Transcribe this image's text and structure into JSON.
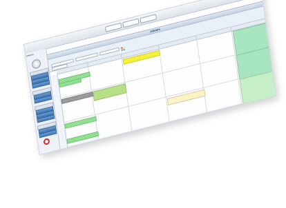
{
  "window": {
    "toolbar_buttons": [
      "",
      "",
      ""
    ],
    "search_text": "",
    "menu_link": ""
  },
  "sidebar": {
    "brand_line1": "Medizin",
    "brand_line2": "",
    "avatar_glyph": "",
    "groups": [
      {
        "label": "",
        "buttons": [
          "",
          "",
          ""
        ]
      },
      {
        "label": "",
        "buttons": [
          "",
          ""
        ]
      },
      {
        "label": "",
        "buttons": [
          "",
          "",
          ""
        ]
      },
      {
        "label": "",
        "buttons": [
          "",
          ""
        ]
      }
    ],
    "help_label": ""
  },
  "main": {
    "title": "AGENDA",
    "tabs": [
      "",
      "",
      ""
    ],
    "filters": [
      "",
      "",
      "",
      ""
    ],
    "columns": [
      "",
      "",
      "",
      "",
      "",
      ""
    ],
    "dates": [
      "",
      "",
      "",
      "",
      "",
      "",
      "",
      "",
      "",
      ""
    ],
    "events": [
      {
        "text": "",
        "color": "#f6ef3c"
      },
      {
        "text": "",
        "color": "#8fe08f"
      },
      {
        "text": "",
        "color": "#8fe08f"
      },
      {
        "text": "",
        "color": "#9a9a9a"
      },
      {
        "text": "",
        "color": "#b7df86"
      },
      {
        "text": "",
        "color": "#8fe08f"
      },
      {
        "text": "",
        "color": "#8fe08f"
      },
      {
        "text": "",
        "color": "#fbf3c4"
      },
      {
        "text": "",
        "color": "#a8e6c0"
      },
      {
        "text": "",
        "color": "#a8e6c0"
      },
      {
        "text": "",
        "color": "#c6efc6"
      }
    ]
  }
}
